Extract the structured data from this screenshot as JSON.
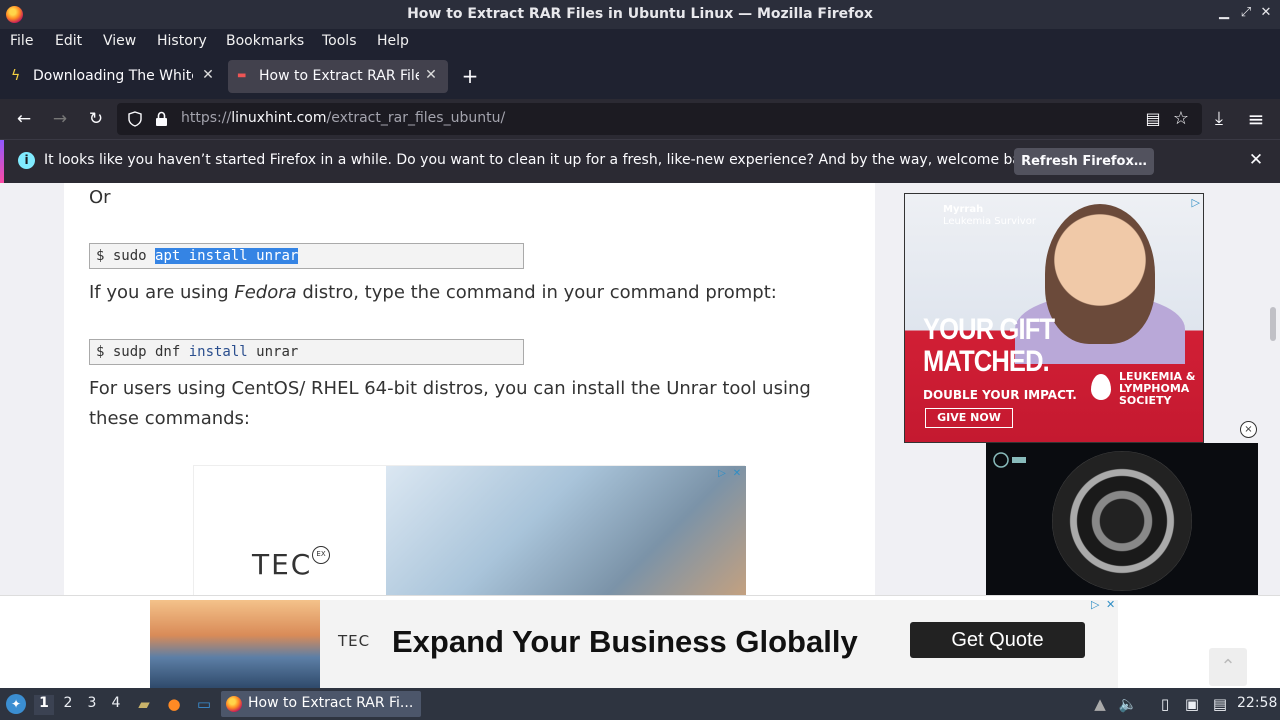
{
  "window": {
    "title": "How to Extract RAR Files in Ubuntu Linux — Mozilla Firefox",
    "minimize": "▁",
    "maximize": "⤢",
    "close": "✕"
  },
  "menu": [
    "File",
    "Edit",
    "View",
    "History",
    "Bookmarks",
    "Tools",
    "Help"
  ],
  "tabs": [
    {
      "label": "Downloading The White Lotus",
      "icon": "lightning-icon",
      "close": "✕",
      "active": false
    },
    {
      "label": "How to Extract RAR Files in Ubuntu",
      "icon": "linuxhint-icon",
      "close": "✕",
      "active": true
    }
  ],
  "new_tab": "+",
  "nav": {
    "back": "←",
    "forward": "→",
    "reload": "↻",
    "url_prefix": "https://",
    "url_domain": "linuxhint.com",
    "url_path": "/extract_rar_files_ubuntu/",
    "reader": "▤",
    "bookmark": "☆",
    "downloads": "⤓",
    "menu": "≡"
  },
  "notification": {
    "icon": "i",
    "message": "It looks like you haven’t started Firefox in a while. Do you want to clean it up for a fresh, like-new experience? And by the way, welcome back!",
    "button": "Refresh Firefox…",
    "close": "✕"
  },
  "article": {
    "or": "Or",
    "code1_prompt": "$ sudo ",
    "code1_selected": "apt install unrar",
    "fedora_pre": "If you are using ",
    "fedora_em": "Fedora",
    "fedora_post": " distro, type the command in your command prompt:",
    "code2_prompt": "$ sudp dnf ",
    "code2_kw": "install",
    "code2_post": " unrar",
    "centos_line1": "For users using CentOS/ RHEL 64-bit distros, you can install the Unrar tool using",
    "centos_line2": "these commands:"
  },
  "ads": {
    "inline_logo": "TEC",
    "inline_logo_badge": "EX",
    "adchoice": "▷",
    "close": "✕",
    "side_name": "Myrrah",
    "side_sub": "Leukemia Survivor",
    "side_big1": "YOUR GIFT",
    "side_big2": "MATCHED.",
    "side_double": "DOUBLE YOUR IMPACT.",
    "side_button": "GIVE NOW",
    "side_org1": "LEUKEMIA &",
    "side_org2": "LYMPHOMA",
    "side_org3": "SOCIETY",
    "video_close": "×",
    "banner_logo": "TEC",
    "banner_headline": "Expand Your Business Globally",
    "banner_button": "Get Quote",
    "back_to_top": "⌃"
  },
  "taskbar": {
    "workspaces": [
      "1",
      "2",
      "3",
      "4"
    ],
    "active_workspace": "1",
    "task_label": "How to Extract RAR Fi...",
    "clock": "22:58"
  }
}
